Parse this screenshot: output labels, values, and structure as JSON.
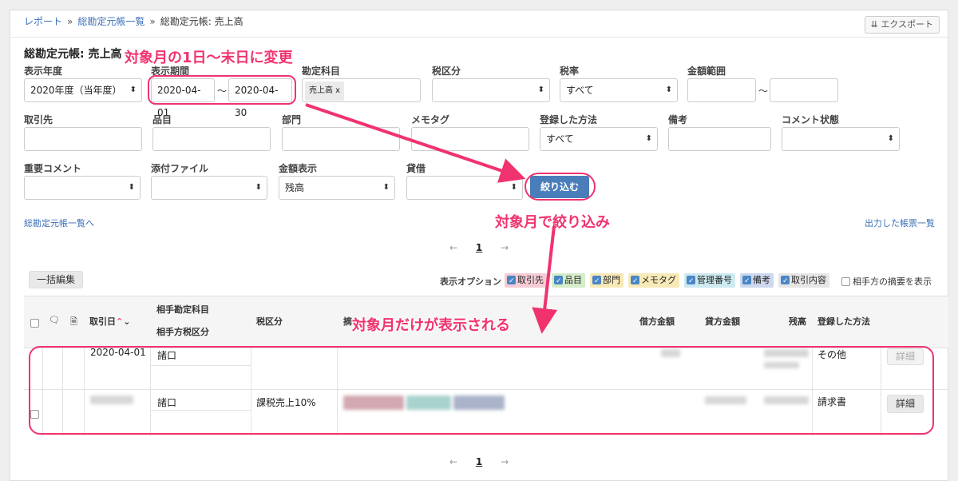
{
  "breadcrumb": {
    "items": [
      "レポート",
      "総勘定元帳一覧"
    ],
    "separator": "»",
    "current": "総勘定元帳: 売上高"
  },
  "export_label": "エクスポート",
  "title": "総勘定元帳: 売上高",
  "filters": {
    "year": {
      "label": "表示年度",
      "value": "2020年度（当年度）"
    },
    "period": {
      "label": "表示期間",
      "start": "2020-04-01",
      "sep": "〜",
      "end": "2020-04-30"
    },
    "account": {
      "label": "勘定科目",
      "tag": "売上高 x"
    },
    "tax": {
      "label": "税区分",
      "value": ""
    },
    "rate": {
      "label": "税率",
      "value": "すべて"
    },
    "amount": {
      "label": "金額範囲",
      "sep": "〜"
    },
    "partner": {
      "label": "取引先"
    },
    "item": {
      "label": "品目"
    },
    "dept": {
      "label": "部門"
    },
    "memo": {
      "label": "メモタグ"
    },
    "method": {
      "label": "登録した方法",
      "value": "すべて"
    },
    "note": {
      "label": "備考"
    },
    "comment_status": {
      "label": "コメント状態"
    },
    "important": {
      "label": "重要コメント"
    },
    "attach": {
      "label": "添付ファイル"
    },
    "amount_display": {
      "label": "金額表示",
      "value": "残高"
    },
    "debit_credit": {
      "label": "貸借"
    },
    "submit": "絞り込む"
  },
  "back_link": "総勘定元帳一覧へ",
  "output_link": "出力した帳票一覧",
  "pager": {
    "prev": "←",
    "page": "1",
    "next": "→"
  },
  "bulk_edit": "一括編集",
  "options": {
    "label": "表示オプション",
    "items": [
      {
        "label": "取引先",
        "color": "#f6cdd6"
      },
      {
        "label": "品目",
        "color": "#d5edc9"
      },
      {
        "label": "部門",
        "color": "#f8eab8"
      },
      {
        "label": "メモタグ",
        "color": "#f8eab8"
      },
      {
        "label": "管理番号",
        "color": "#cdeaf0"
      },
      {
        "label": "備考",
        "color": "#cdd8ef"
      },
      {
        "label": "取引内容",
        "color": "#e6e6e6"
      }
    ],
    "counterparty_summary": "相手方の摘要を表示"
  },
  "table": {
    "headers": {
      "date": "取引日",
      "counter_account": "相手勘定科目",
      "counter_tax": "相手方税区分",
      "tax": "税区分",
      "summary": "摘",
      "debit": "借方金額",
      "credit": "貸方金額",
      "balance": "残高",
      "method": "登録した方法"
    },
    "rows": [
      {
        "date": "2020-04-01",
        "account": "諸口",
        "tax": "",
        "method": "その他",
        "action": "詳細"
      },
      {
        "date": "",
        "account": "諸口",
        "tax": "課税売上10%",
        "method": "請求書",
        "action": "詳細"
      }
    ]
  },
  "annotations": {
    "a1": "対象月の1日〜末日に変更",
    "a2": "対象月で絞り込み",
    "a3": "対象月だけが表示される"
  }
}
